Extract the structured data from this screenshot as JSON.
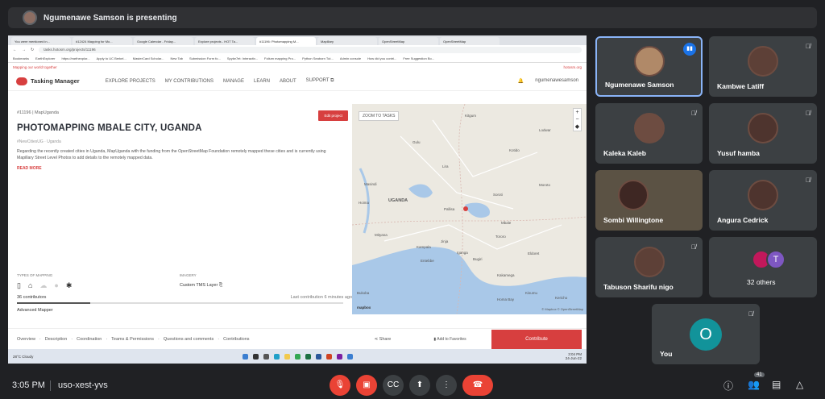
{
  "banner": {
    "presenter_text": "Ngumenawe Samson is presenting"
  },
  "browser": {
    "tabs": [
      "You were mentioned in...",
      "#12424 Mapping for Mo...",
      "Google Calendar - Friday...",
      "Explore projects - HOT Ta...",
      "#11196: Photomapping M...",
      "Mapillary",
      "OpenStreetMap",
      "OpenStreetMap"
    ],
    "url": "tasks.hotosm.org/projects/11196",
    "bookmarks": [
      "Bookmarks",
      "EarthExplorer",
      "https://earthexplor...",
      "Apply to UC Berkel...",
      "MasterCard Scholar...",
      "New Tab",
      "Submission Form fo...",
      "Spyke7et: Interactiv...",
      "Folium mapping Pro...",
      "Python Seaborn Tut...",
      "Admin console",
      "How did you contri...",
      "Free Suggestion Bo..."
    ]
  },
  "tm": {
    "notice": "Mapping our world together",
    "site": "hotosm.org",
    "logo": "Tasking Manager",
    "nav": [
      "EXPLORE PROJECTS",
      "MY CONTRIBUTIONS",
      "MANAGE",
      "LEARN",
      "ABOUT",
      "SUPPORT ⧉"
    ],
    "user": "ngumenawesamson"
  },
  "project": {
    "id": "#11196 | MapUganda",
    "edit": "Edit project",
    "title": "PHOTOMAPPING MBALE CITY, UGANDA",
    "tags": "#NewCitiesUG · Uganda",
    "description": "Regarding the recently created cities in Uganda, MapUganda with the funding from the OpenStreetMap Foundation remotely mapped these cities and is currently using Mapillary Street Level Photos to add details to the remotely mapped data.",
    "read_more": "READ MORE",
    "types_label": "TYPES OF MAPPING",
    "imagery_label": "IMAGERY",
    "imagery_value": "Custom TMS Layer",
    "contributors": "36 contributors",
    "last_contribution": "Last contribution 6 minutes ago",
    "progress_fraction": 0.225,
    "level": "Advanced Mapper"
  },
  "map": {
    "zoom_to_tasks": "ZOOM TO TASKS",
    "cities": [
      "Gulu",
      "Lira",
      "Soroti",
      "Masindi",
      "Hoima",
      "UGANDA",
      "Kampala",
      "Jinja",
      "Mbale",
      "Tororo",
      "Pallisa",
      "Kitgum",
      "Kotido",
      "Moroto",
      "Lodwar",
      "Iganga",
      "Bugiri",
      "Mityana",
      "Kakamega",
      "Eldoret",
      "Kisumu",
      "Kericho",
      "Bukoba",
      "Entebbe",
      "Homa Bay"
    ],
    "attribution": "© Mapbox © OpenStreetMap",
    "brand": "mapbox"
  },
  "bottom_tabs": [
    "Overview",
    "Description",
    "Coordination",
    "Teams & Permissions",
    "Questions and comments",
    "Contributions"
  ],
  "actions": {
    "share": "Share",
    "favorite": "Add to Favorites",
    "contribute": "Contribute"
  },
  "taskbar": {
    "weather": "28°C Cloudy",
    "clock": "3:04 PM",
    "date": "24-Jun-22"
  },
  "participants": [
    {
      "name": "Ngumenawe Samson"
    },
    {
      "name": "Kambwe Latiff"
    },
    {
      "name": "Kaleka Kaleb"
    },
    {
      "name": "Yusuf hamba"
    },
    {
      "name": "Sombi Willingtone"
    },
    {
      "name": "Angura Cedrick"
    },
    {
      "name": "Tabuson Sharifu nigo"
    },
    {
      "name": "32 others",
      "initial": "T"
    },
    {
      "name": "You",
      "initial": "O"
    }
  ],
  "bottom_bar": {
    "time": "3:05 PM",
    "meeting_code": "uso-xest-yvs",
    "people_count": "41"
  }
}
